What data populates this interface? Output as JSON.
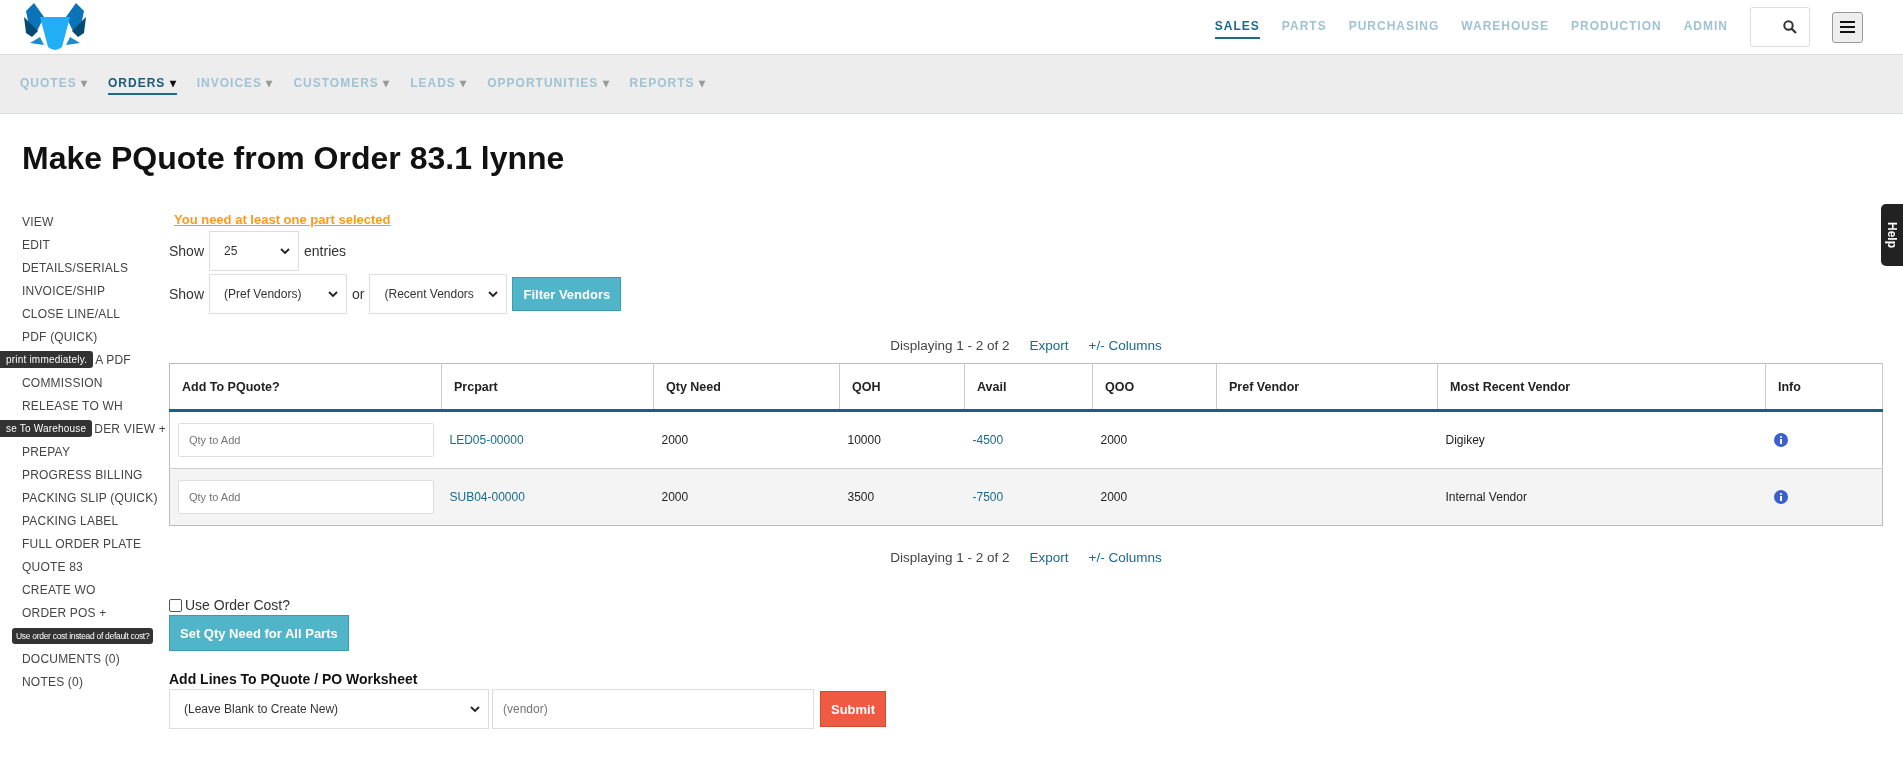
{
  "top_nav": [
    {
      "label": "SALES",
      "selected": true
    },
    {
      "label": "PARTS",
      "selected": false
    },
    {
      "label": "PURCHASING",
      "selected": false
    },
    {
      "label": "WAREHOUSE",
      "selected": false
    },
    {
      "label": "PRODUCTION",
      "selected": false
    },
    {
      "label": "ADMIN",
      "selected": false
    }
  ],
  "sub_nav": [
    {
      "label": "QUOTES",
      "caret": "▾",
      "selected": false
    },
    {
      "label": "ORDERS",
      "caret": "▾",
      "selected": true
    },
    {
      "label": "INVOICES",
      "caret": "▾",
      "selected": false
    },
    {
      "label": "CUSTOMERS",
      "caret": "▾",
      "selected": false
    },
    {
      "label": "LEADS",
      "caret": "▾",
      "selected": false
    },
    {
      "label": "OPPORTUNITIES",
      "caret": "▾",
      "selected": false
    },
    {
      "label": "REPORTS",
      "caret": "▾",
      "selected": false
    }
  ],
  "page_title": "Make PQuote from Order 83.1 lynne",
  "help_tab": "Help",
  "sidebar": [
    {
      "label": "VIEW"
    },
    {
      "label": "EDIT"
    },
    {
      "label": "DETAILS/SERIALS"
    },
    {
      "label": "INVOICE/SHIP"
    },
    {
      "label": "CLOSE LINE/ALL"
    },
    {
      "label": "PDF (QUICK)"
    },
    {
      "label": "A PDF",
      "tooltip": "print immediately."
    },
    {
      "label": "COMMISSION"
    },
    {
      "label": "RELEASE TO WH"
    },
    {
      "label": "DER VIEW +",
      "tooltip": "se To Warehouse"
    },
    {
      "label": "PREPAY"
    },
    {
      "label": "PROGRESS BILLING"
    },
    {
      "label": "PACKING SLIP (QUICK)"
    },
    {
      "label": "PACKING LABEL"
    },
    {
      "label": "FULL ORDER PLATE"
    },
    {
      "label": "QUOTE 83"
    },
    {
      "label": "CREATE WO"
    },
    {
      "label": "ORDER POS +"
    },
    {
      "tooltip": "Use order cost instead of default cost?"
    },
    {
      "label": "DOCUMENTS (0)"
    },
    {
      "label": "NOTES (0)"
    }
  ],
  "warning": "You need at least one part selected",
  "entries_control": {
    "prefix": "Show",
    "value": "25",
    "suffix": "entries"
  },
  "vendor_filter": {
    "prefix": "Show",
    "pref_value": "(Pref Vendors)",
    "joiner": "or",
    "recent_value": "(Recent Vendors",
    "button": "Filter Vendors"
  },
  "table_info_top": {
    "displaying": "Displaying 1 - 2 of 2",
    "export": "Export",
    "columns": "+/- Columns"
  },
  "table": {
    "columns": [
      "Add To PQuote?",
      "Prcpart",
      "Qty Need",
      "QOH",
      "Avail",
      "QOO",
      "Pref Vendor",
      "Most Recent Vendor",
      "Info"
    ],
    "rows": [
      {
        "placeholder": "Qty to Add",
        "prcpart": "LED05-00000",
        "qty_need": "2000",
        "qoh": "10000",
        "avail": "-4500",
        "qoo": "2000",
        "most_recent_vendor": "Digikey"
      },
      {
        "placeholder": "Qty to Add",
        "prcpart": "SUB04-00000",
        "qty_need": "2000",
        "qoh": "3500",
        "avail": "-7500",
        "qoo": "2000",
        "most_recent_vendor": "Internal Vendor"
      }
    ]
  },
  "table_info_bottom": {
    "displaying": "Displaying 1 - 2 of 2",
    "export": "Export",
    "columns": "+/- Columns"
  },
  "use_order_cost": {
    "label": "Use Order Cost?",
    "checked": false
  },
  "set_qty_button": "Set Qty Need for All Parts",
  "worksheet": {
    "heading": "Add Lines To PQuote / PO Worksheet",
    "select_value": "(Leave Blank to Create New)",
    "vendor_placeholder": "(vendor)",
    "submit": "Submit"
  }
}
